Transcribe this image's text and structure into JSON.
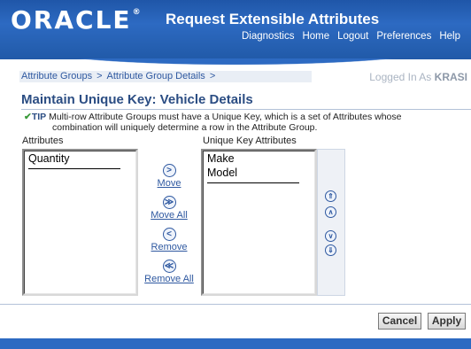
{
  "header": {
    "logo_text": "ORACLE",
    "logo_mark": "®",
    "app_title": "Request Extensible Attributes",
    "links": [
      "Diagnostics",
      "Home",
      "Logout",
      "Preferences",
      "Help"
    ]
  },
  "breadcrumb": {
    "items": [
      "Attribute Groups",
      "Attribute Group Details"
    ],
    "separator": ">"
  },
  "logged_in": {
    "prefix": "Logged In As",
    "user": "KRASI"
  },
  "page": {
    "title": "Maintain Unique Key: Vehicle Details",
    "tip_label": "TIP",
    "tip_line1": "Multi-row Attribute Groups must have a Unique Key, which is a set of Attributes whose",
    "tip_line2": "combination will uniquely determine a row in the Attribute Group."
  },
  "shuttle": {
    "left_label": "Attributes",
    "right_label": "Unique Key Attributes",
    "left_items": [
      "Quantity"
    ],
    "right_items": [
      "Make",
      "Model"
    ],
    "move": "Move",
    "move_all": "Move All",
    "remove": "Remove",
    "remove_all": "Remove All"
  },
  "buttons": {
    "cancel": "Cancel",
    "apply": "Apply"
  },
  "colors": {
    "brand_blue": "#2d6ac2",
    "link_blue": "#2e58a0",
    "title_blue": "#2b4d83"
  }
}
